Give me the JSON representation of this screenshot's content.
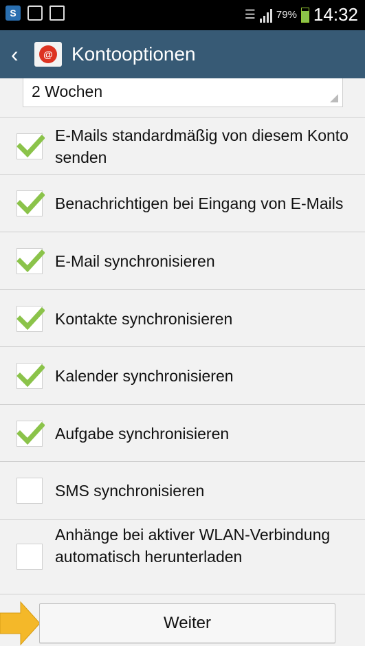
{
  "status_bar": {
    "icons_left": [
      "samsung-s-icon",
      "image-icon",
      "briefcase-icon"
    ],
    "battery_percent": "79%",
    "battery_level": 0.79,
    "time": "14:32"
  },
  "action_bar": {
    "title": "Kontooptionen",
    "back_icon": "chevron-left-icon",
    "app_icon": "email-app-icon"
  },
  "dropdown": {
    "value": "2 Wochen"
  },
  "options": [
    {
      "label": "E-Mails standardmäßig von diesem Konto senden",
      "checked": true
    },
    {
      "label": "Benachrichtigen bei Eingang von E-Mails",
      "checked": true
    },
    {
      "label": "E-Mail synchronisieren",
      "checked": true
    },
    {
      "label": "Kontakte synchronisieren",
      "checked": true
    },
    {
      "label": "Kalender synchronisieren",
      "checked": true
    },
    {
      "label": "Aufgabe synchronisieren",
      "checked": true
    },
    {
      "label": "SMS synchronisieren",
      "checked": false
    },
    {
      "label": "Anhänge bei aktiver WLAN-Verbindung automatisch herunterladen",
      "checked": false
    }
  ],
  "next_button": {
    "label": "Weiter"
  },
  "colors": {
    "action_bar": "#375a75",
    "check": "#8bc34a",
    "pointer_arrow": "#f4b829"
  }
}
